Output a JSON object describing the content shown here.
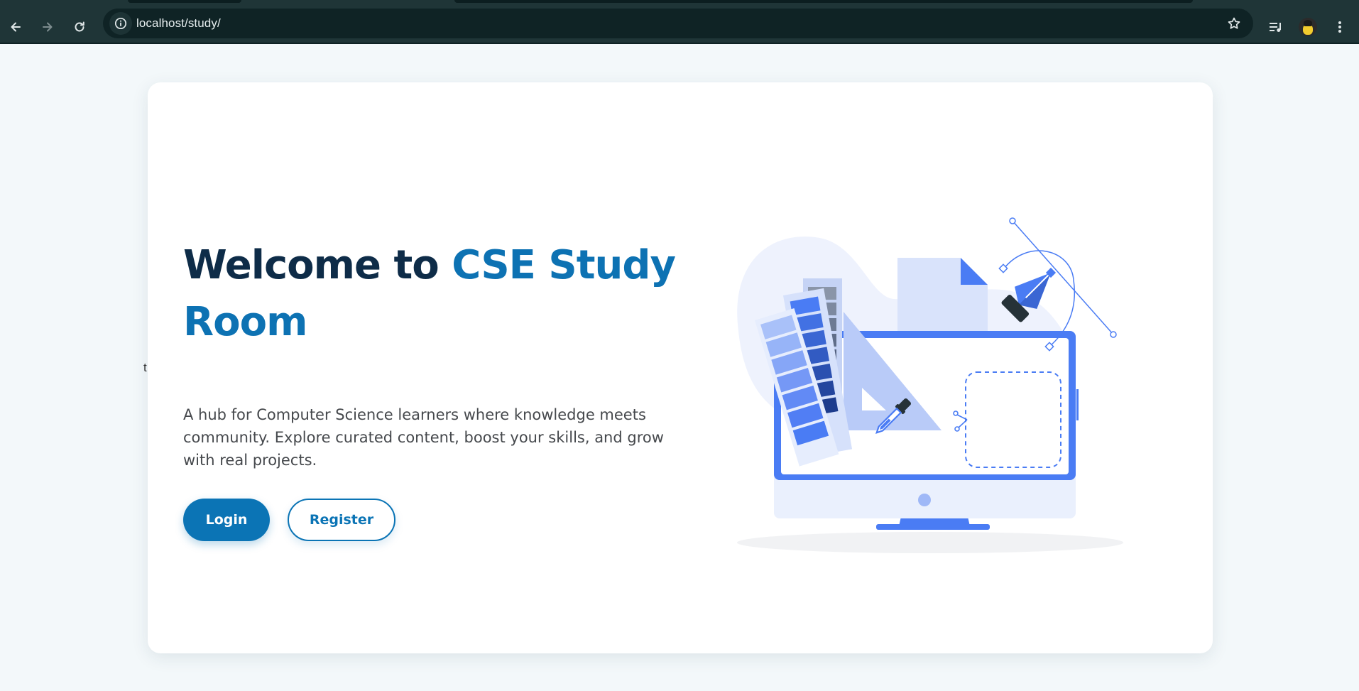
{
  "browser": {
    "url": "localhost/study/",
    "icons": {
      "back": "arrow-left-icon",
      "forward": "arrow-right-icon",
      "reload": "reload-icon",
      "site_info": "info-icon",
      "bookmark": "star-icon",
      "media": "queue-music-icon",
      "profile": "avatar",
      "menu": "kebab-menu-icon"
    }
  },
  "page": {
    "stray_text": "t",
    "hero": {
      "title_prefix": "Welcome to ",
      "title_accent": "CSE Study Room",
      "description": "A hub for Computer Science learners where knowledge meets community. Explore curated content, boost your skills, and grow with real projects.",
      "login_label": "Login",
      "register_label": "Register"
    }
  },
  "colors": {
    "chrome": "#1f3537",
    "omnibox": "#0f2325",
    "title_dark": "#0e2c48",
    "accent": "#0d72b3",
    "button_primary": "#0b74b5",
    "illustration_blue": "#4a7cf4"
  }
}
